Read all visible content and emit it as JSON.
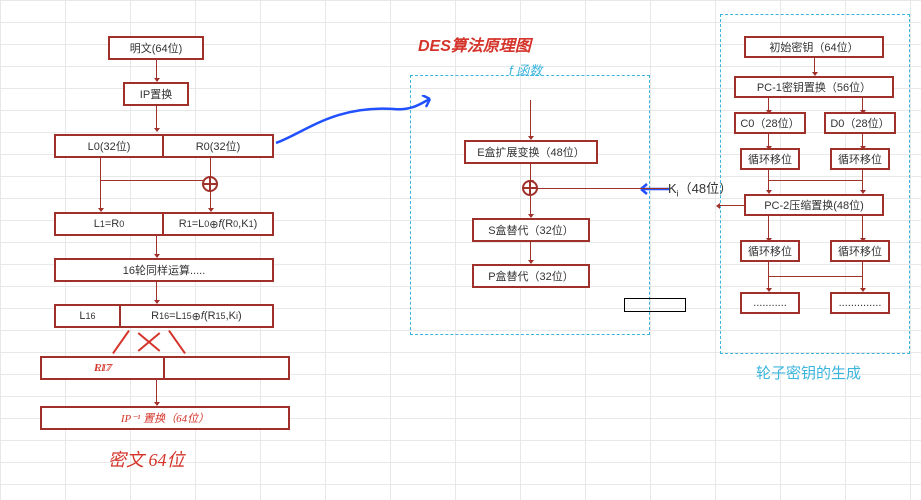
{
  "title": "DES算法原理图",
  "fLabel": "f 函数",
  "keyGenLabel": "轮子密钥的生成",
  "kiLabel": "Ki（48位）",
  "left": {
    "plaintext": "明文(64位)",
    "ipPerm": "IP置换",
    "l0": "L0(32位)",
    "r0": "R0(32位)",
    "l1": "L1=R0",
    "r1": "R1=L0 ⊕ f(R0,K1)",
    "rounds16": "16轮同样运算.....",
    "l16": "L16",
    "r16": "R16=L15 ⊕ f(R15,Ki)",
    "l17": "L17",
    "r17": "R17",
    "ipInv": "IP⁻¹ 置换（64位）",
    "cipher": "密文 64位"
  },
  "fbox": {
    "expand": "E盒扩展变换（48位）",
    "sbox": "S盒替代（32位）",
    "pbox": "P盒替代（32位）"
  },
  "key": {
    "initKey": "初始密钥（64位）",
    "pc1": "PC-1密钥置换（56位）",
    "c0": "C0（28位）",
    "d0": "D0（28位）",
    "shift1a": "循环移位",
    "shift1b": "循环移位",
    "pc2": "PC-2压缩置换(48位)",
    "shift2a": "循环移位",
    "shift2b": "循环移位",
    "dots1": "...........",
    "dots2": ".............."
  }
}
